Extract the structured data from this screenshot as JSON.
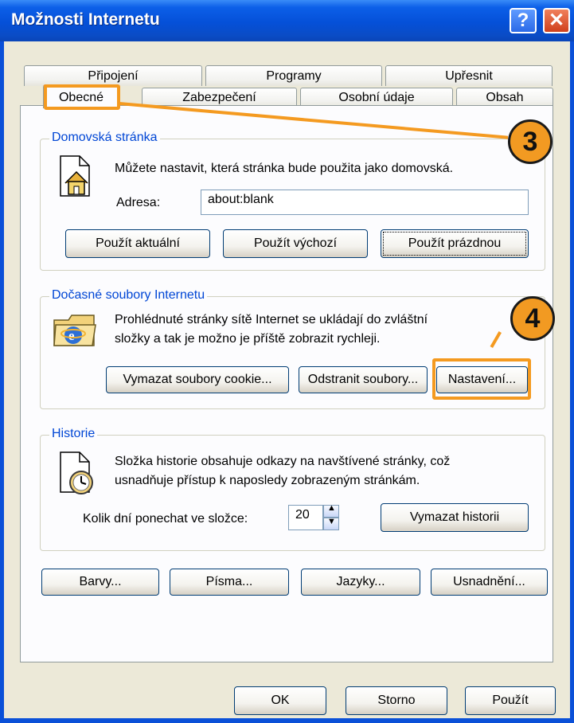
{
  "window": {
    "title": "Možnosti Internetu"
  },
  "tabs": {
    "top_row": [
      "Připojení",
      "Programy",
      "Upřesnit"
    ],
    "bottom_row": [
      "Obecné",
      "Zabezpečení",
      "Osobní údaje",
      "Obsah"
    ],
    "active": "Obecné"
  },
  "home": {
    "title": "Domovská stránka",
    "description": "Můžete nastavit, která stránka bude použita jako domovská.",
    "address_label": "Adresa:",
    "address_value": "about:blank",
    "buttons": [
      "Použít aktuální",
      "Použít výchozí",
      "Použít prázdnou"
    ]
  },
  "temp": {
    "title": "Dočasné soubory Internetu",
    "description_line1": "Prohlédnuté stránky sítě Internet se ukládají do zvláštní",
    "description_line2": "složky a tak je možno je příště zobrazit rychleji.",
    "buttons": [
      "Vymazat soubory cookie...",
      "Odstranit soubory...",
      "Nastavení..."
    ]
  },
  "history": {
    "title": "Historie",
    "description_line1": "Složka historie obsahuje odkazy na navštívené stránky, což",
    "description_line2": "usnadňuje přístup k naposledy zobrazeným stránkám.",
    "days_label": "Kolik dní ponechat ve složce:",
    "days_value": "20",
    "clear_button": "Vymazat historii"
  },
  "bottom_buttons": [
    "Barvy...",
    "Písma...",
    "Jazyky...",
    "Usnadnění..."
  ],
  "dialog_buttons": {
    "ok": "OK",
    "cancel": "Storno",
    "apply": "Použít"
  },
  "callouts": {
    "three": "3",
    "four": "4"
  },
  "colors": {
    "callout": "#f49a20",
    "group_title": "#0046d5",
    "titlebar": "#0550d8"
  },
  "icons": [
    "help-icon",
    "close-icon",
    "home-page-icon",
    "ie-folder-icon",
    "history-clock-icon",
    "spin-up-icon",
    "spin-down-icon"
  ]
}
